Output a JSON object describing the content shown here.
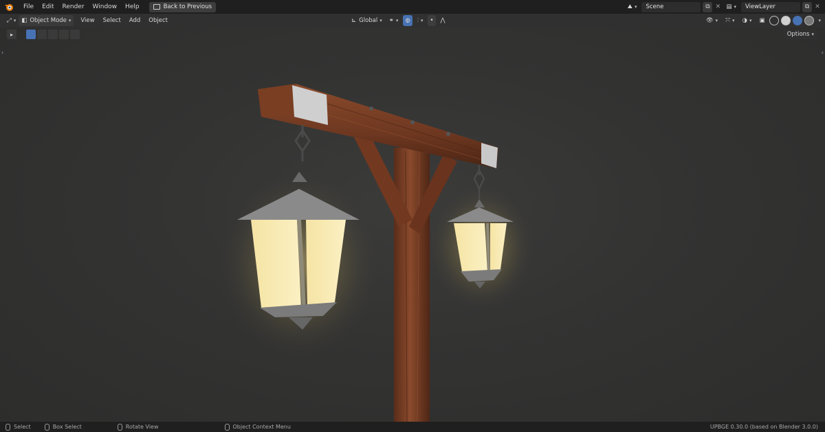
{
  "menubar": {
    "items": [
      "File",
      "Edit",
      "Render",
      "Window",
      "Help"
    ],
    "back_button": "Back to Previous"
  },
  "scene_selector": {
    "value": "Scene"
  },
  "viewlayer_selector": {
    "value": "ViewLayer"
  },
  "viewport_header": {
    "mode": "Object Mode",
    "menus": [
      "View",
      "Select",
      "Add",
      "Object"
    ],
    "transform_orientation": "Global",
    "options_label": "Options"
  },
  "statusbar": {
    "select": "Select",
    "box_select": "Box Select",
    "rotate_view": "Rotate View",
    "context_menu": "Object Context Menu",
    "version": "UPBGE 0.30.0 (based on Blender 3.0.0)"
  },
  "colors": {
    "accent": "#4772b3",
    "topbar": "#1f1f1f",
    "header": "#303030",
    "wood": "#7a3f26",
    "lantern_glow": "#f6e6a8"
  }
}
